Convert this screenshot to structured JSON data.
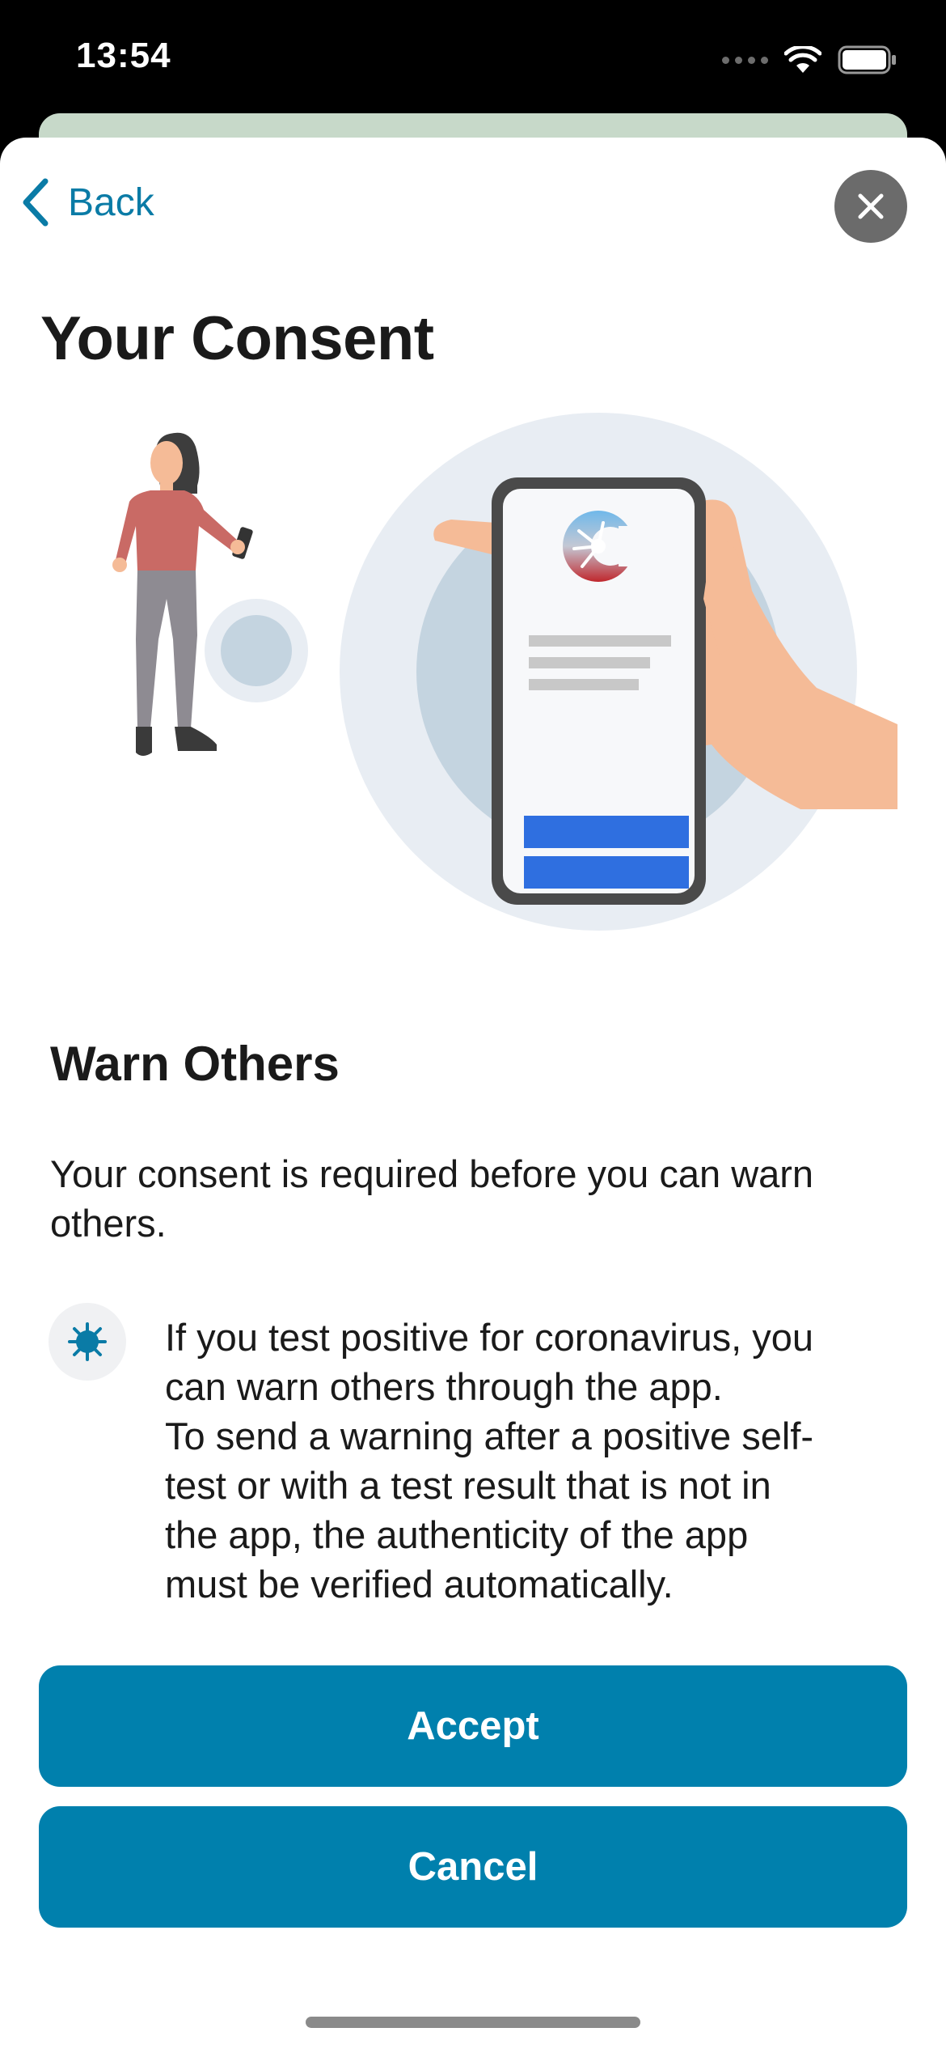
{
  "status_bar": {
    "time": "13:54"
  },
  "nav": {
    "back_label": "Back"
  },
  "header": {
    "title": "Your Consent"
  },
  "content": {
    "section_title": "Warn Others",
    "intro": "Your consent is required before you can warn others.",
    "info_lines": [
      "If you test positive for coronavirus, you",
      "can warn others through the app.",
      "To send a warning after a positive self-",
      "test or with a test result that is not in",
      "the app, the authenticity of the app",
      "must be verified automatically."
    ]
  },
  "buttons": {
    "accept_label": "Accept",
    "cancel_label": "Cancel"
  },
  "colors": {
    "accent": "#0080ad",
    "link": "#0a7ba6",
    "close_bg": "#6b6b6b",
    "text": "#1a1a1a"
  },
  "icons": [
    "wifi-icon",
    "battery-icon",
    "back-chevron-icon",
    "close-icon",
    "virus-icon"
  ]
}
